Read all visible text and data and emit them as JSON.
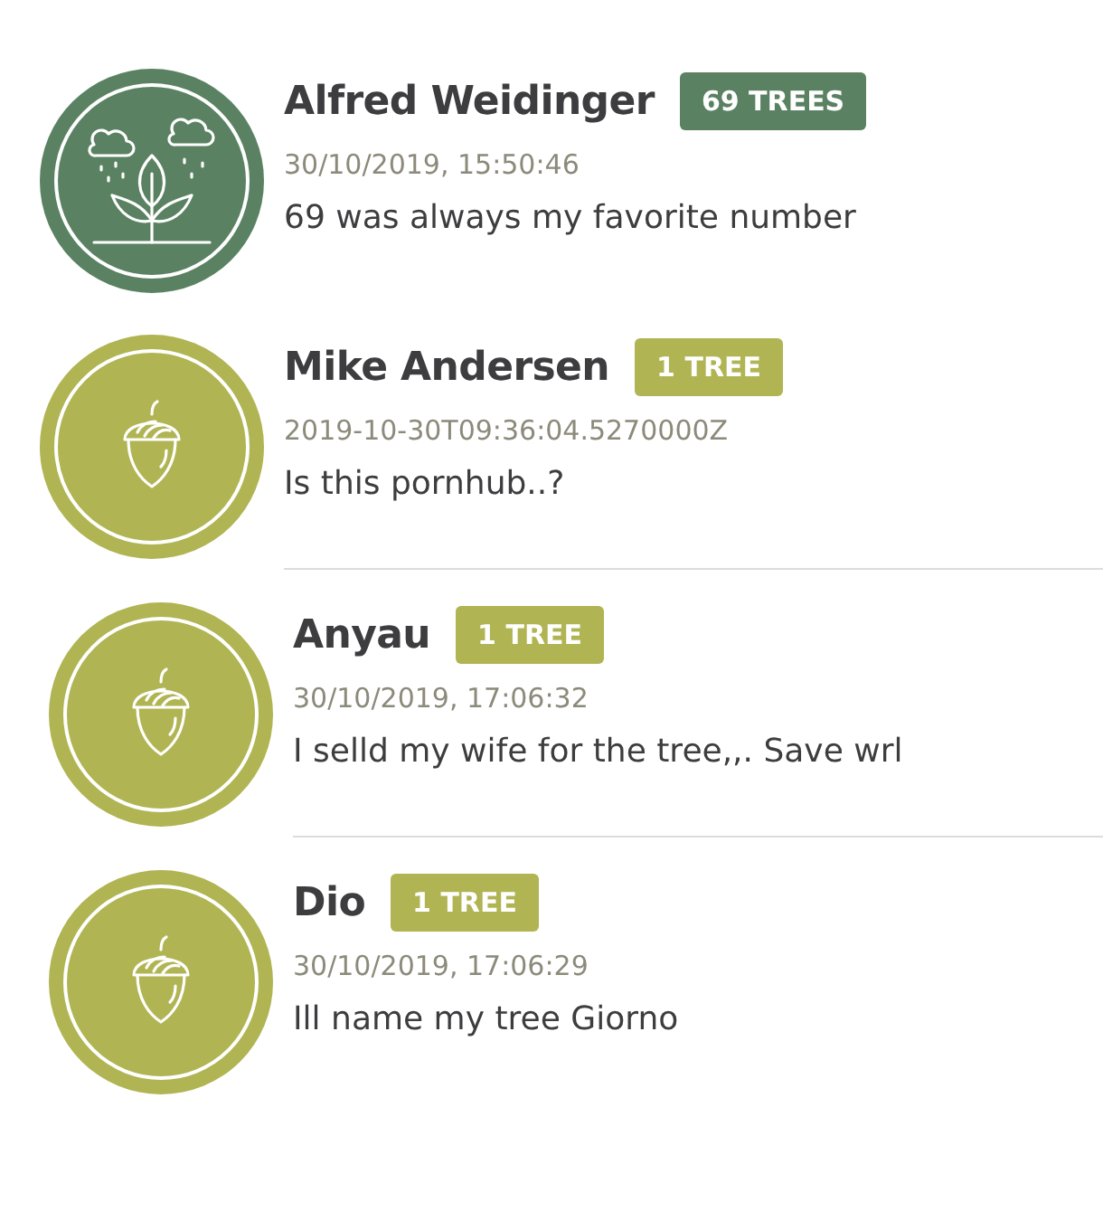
{
  "comments": [
    {
      "name": "Alfred Weidinger",
      "badge": "69 TREES",
      "date": "30/10/2019, 15:50:46",
      "text": "69 was always my favorite number",
      "kind": "plant",
      "color": "#5a8262",
      "divider": false
    },
    {
      "name": "Mike Andersen",
      "badge": "1 TREE",
      "date": "2019-10-30T09:36:04.5270000Z",
      "text": "Is this pornhub..?",
      "kind": "acorn",
      "color": "#b0b452",
      "divider": true
    },
    {
      "name": "Anyau",
      "badge": "1 TREE",
      "date": "30/10/2019, 17:06:32",
      "text": "I selld my wife for the tree,,. Save wrl",
      "kind": "acorn",
      "color": "#b0b452",
      "divider": true
    },
    {
      "name": "Dio",
      "badge": "1 TREE",
      "date": "30/10/2019, 17:06:29",
      "text": "Ill name my tree Giorno",
      "kind": "acorn",
      "color": "#b0b452",
      "divider": false
    }
  ]
}
